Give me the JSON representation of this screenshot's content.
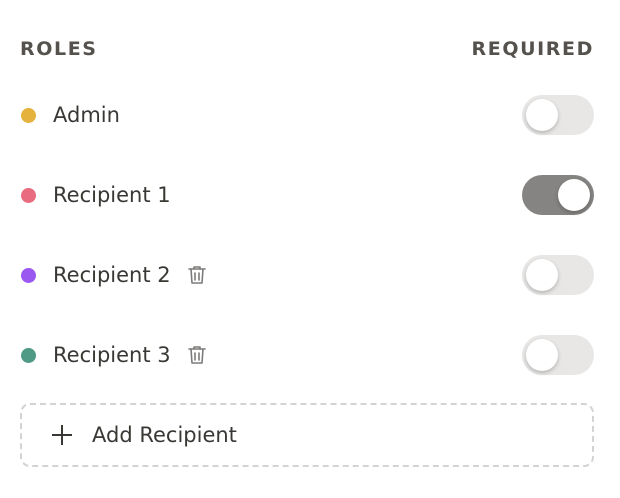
{
  "header": {
    "roles_label": "ROLES",
    "required_label": "REQUIRED"
  },
  "roles": [
    {
      "label": "Admin",
      "color": "#e5b33d",
      "required": false,
      "deletable": false
    },
    {
      "label": "Recipient 1",
      "color": "#e86b80",
      "required": true,
      "deletable": false
    },
    {
      "label": "Recipient 2",
      "color": "#9a58f0",
      "required": false,
      "deletable": true,
      "delete_icon": "trash-icon"
    },
    {
      "label": "Recipient 3",
      "color": "#4f9a86",
      "required": false,
      "deletable": true,
      "delete_icon": "trash-icon"
    }
  ],
  "add_button": {
    "label": "Add Recipient",
    "icon": "plus-icon"
  },
  "colors": {
    "toggle_on": "#858482",
    "toggle_off": "#e8e7e6",
    "text": "#3a3835"
  }
}
